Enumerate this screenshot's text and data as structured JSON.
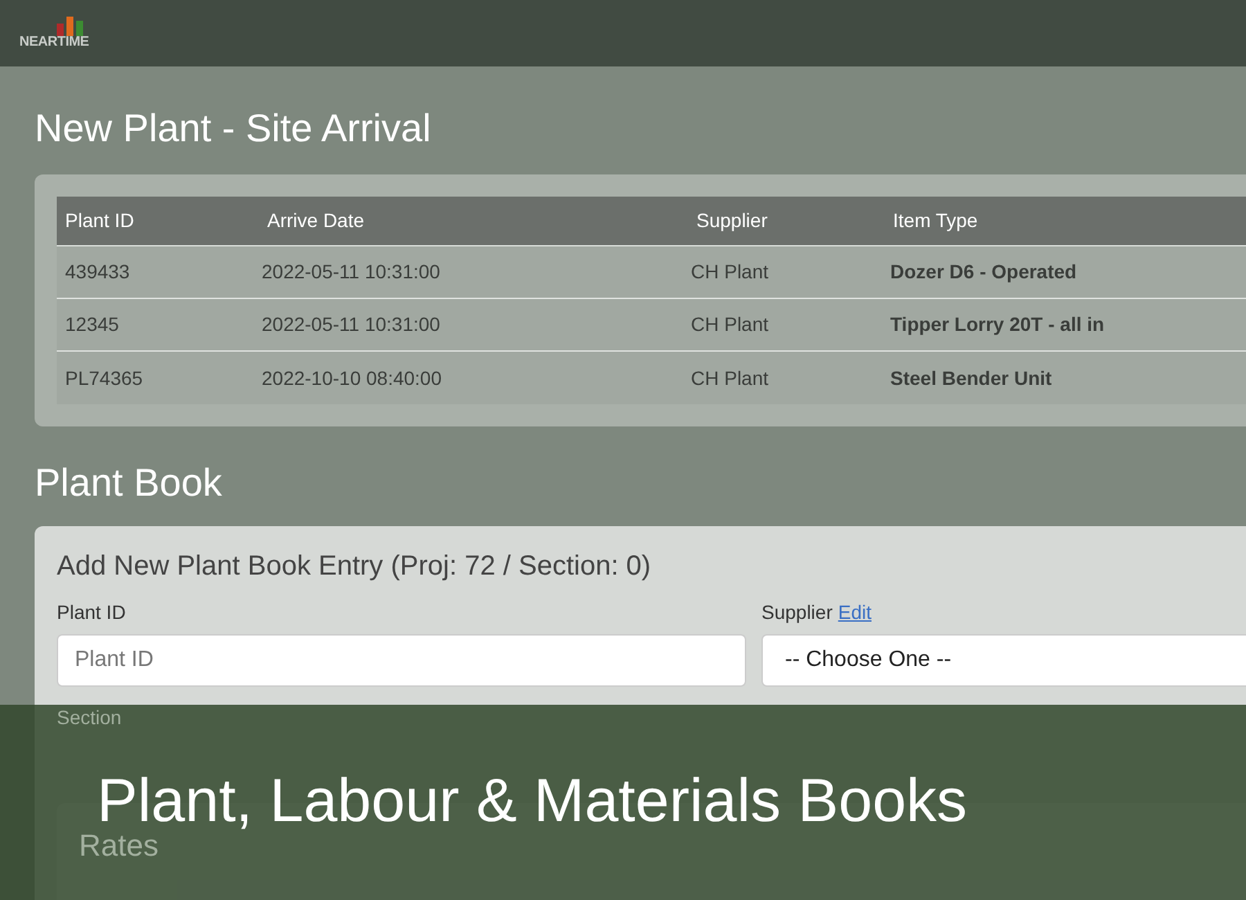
{
  "header": {
    "logo_text": "NEARTIME"
  },
  "arrivals": {
    "title": "New Plant - Site Arrival",
    "columns": [
      "Plant ID",
      "Arrive Date",
      "Supplier",
      "Item Type"
    ],
    "rows": [
      {
        "plant_id": "439433",
        "arrive_date": "2022-05-11 10:31:00",
        "supplier": "CH Plant",
        "item_type": "Dozer D6 - Operated"
      },
      {
        "plant_id": "12345",
        "arrive_date": "2022-05-11 10:31:00",
        "supplier": "CH Plant",
        "item_type": "Tipper Lorry 20T - all in"
      },
      {
        "plant_id": "PL74365",
        "arrive_date": "2022-10-10 08:40:00",
        "supplier": "CH Plant",
        "item_type": "Steel Bender Unit"
      }
    ]
  },
  "plant_book": {
    "title": "Plant Book",
    "form_title": "Add New Plant Book Entry (Proj: 72 / Section: 0)",
    "plant_id_label": "Plant ID",
    "plant_id_placeholder": "Plant ID",
    "supplier_label": "Supplier",
    "supplier_link": "Edit",
    "supplier_value": "-- Choose One --",
    "section_label": "Section",
    "rates_title": "Rates"
  },
  "banner": {
    "text": "Plant, Labour & Materials Books"
  }
}
